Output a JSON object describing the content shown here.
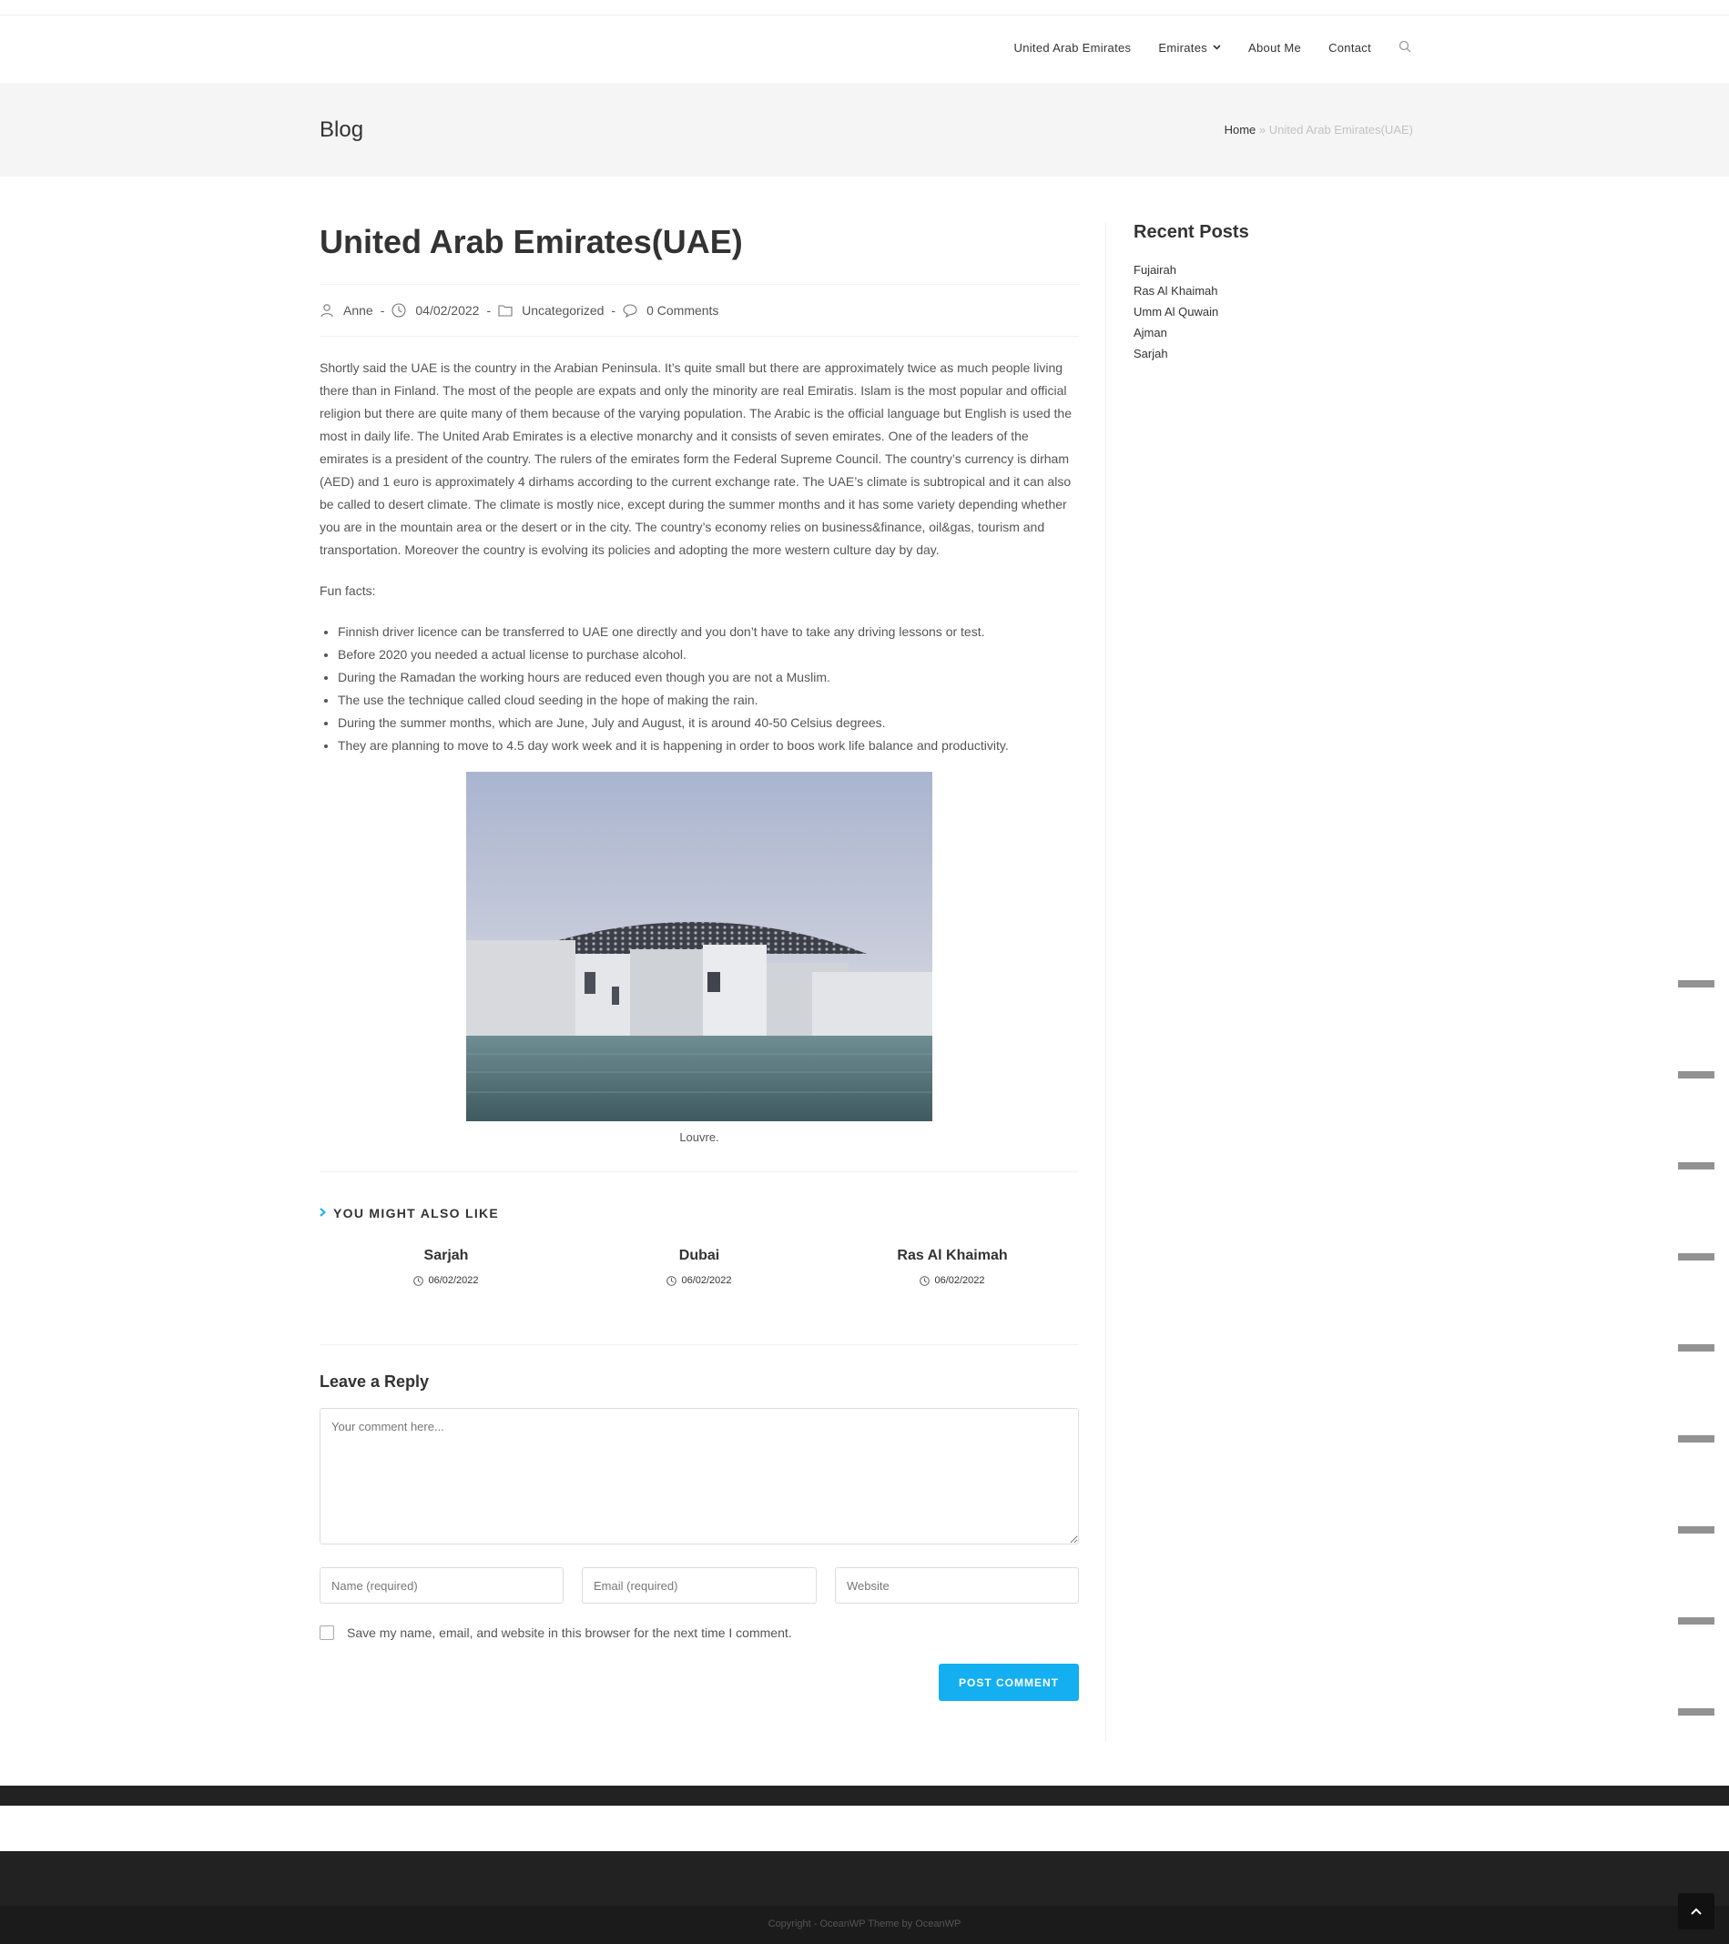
{
  "header": {
    "nav": [
      {
        "label": "United Arab Emirates"
      },
      {
        "label": "Emirates",
        "dropdown": true
      },
      {
        "label": "About Me"
      },
      {
        "label": "Contact"
      }
    ],
    "search_icon": "search-icon"
  },
  "title_bar": {
    "title": "Blog",
    "breadcrumb": {
      "home": "Home",
      "separator": "»",
      "current": "United Arab Emirates(UAE)"
    }
  },
  "post": {
    "title": "United Arab Emirates(UAE)",
    "meta": {
      "author": "Anne",
      "date": "04/02/2022",
      "category": "Uncategorized",
      "comments": "0 Comments",
      "separator": "-"
    },
    "paragraph": "Shortly said the UAE is the country in the Arabian Peninsula. It’s quite small but there are approximately twice as much people living there than in Finland. The most of the people are expats and only the minority are real Emiratis. Islam is the most popular and official religion but there are quite many of them because of the varying population. The Arabic is the official language but English is used the most in daily life. The United Arab Emirates is a elective monarchy and it consists of seven emirates. One of the leaders of the emirates is a president of the country. The rulers of the emirates form the Federal Supreme Council. The country’s currency is dirham (AED) and 1 euro is approximately 4 dirhams according to the current exchange rate. The UAE’s climate is subtropical and it can also be called to desert climate. The climate is mostly nice, except during the summer months and it has some variety depending whether you are in the mountain area or the desert or in the city. The country’s economy relies on business&finance, oil&gas, tourism and transportation. Moreover the country is evolving its policies and adopting the more western culture day by day.",
    "fun_facts_label": "Fun facts:",
    "facts": [
      "Finnish driver licence can be transferred to UAE one directly and you don’t have to take any driving lessons or test.",
      "Before 2020 you needed a actual license to purchase alcohol.",
      "During the Ramadan the working hours are reduced even though you are not a Muslim.",
      "The use the technique called cloud seeding in the hope of making the rain.",
      "During the summer months, which are June, July and August, it is around 40-50 Celsius degrees.",
      "They are planning to move to 4.5 day work week and it is happening in order to boos work life balance and productivity."
    ],
    "image_caption": "Louvre."
  },
  "related": {
    "heading": "YOU MIGHT ALSO LIKE",
    "items": [
      {
        "title": "Sarjah",
        "date": "06/02/2022"
      },
      {
        "title": "Dubai",
        "date": "06/02/2022"
      },
      {
        "title": "Ras Al Khaimah",
        "date": "06/02/2022"
      }
    ]
  },
  "reply": {
    "heading": "Leave a Reply",
    "comment_placeholder": "Your comment here...",
    "name_placeholder": "Name (required)",
    "email_placeholder": "Email (required)",
    "website_placeholder": "Website",
    "consent_label": "Save my name, email, and website in this browser for the next time I comment.",
    "submit_label": "POST COMMENT"
  },
  "sidebar": {
    "title": "Recent Posts",
    "posts": [
      "Fujairah",
      "Ras Al Khaimah",
      "Umm Al Quwain",
      "Ajman",
      "Sarjah"
    ]
  },
  "footer": {
    "copyright": "Copyright - OceanWP Theme by OceanWP"
  },
  "colors": {
    "accent": "#13aff0",
    "text": "#555555",
    "heading": "#333333",
    "title_bar_bg": "#f5f5f5",
    "footer_bg": "#222222"
  }
}
